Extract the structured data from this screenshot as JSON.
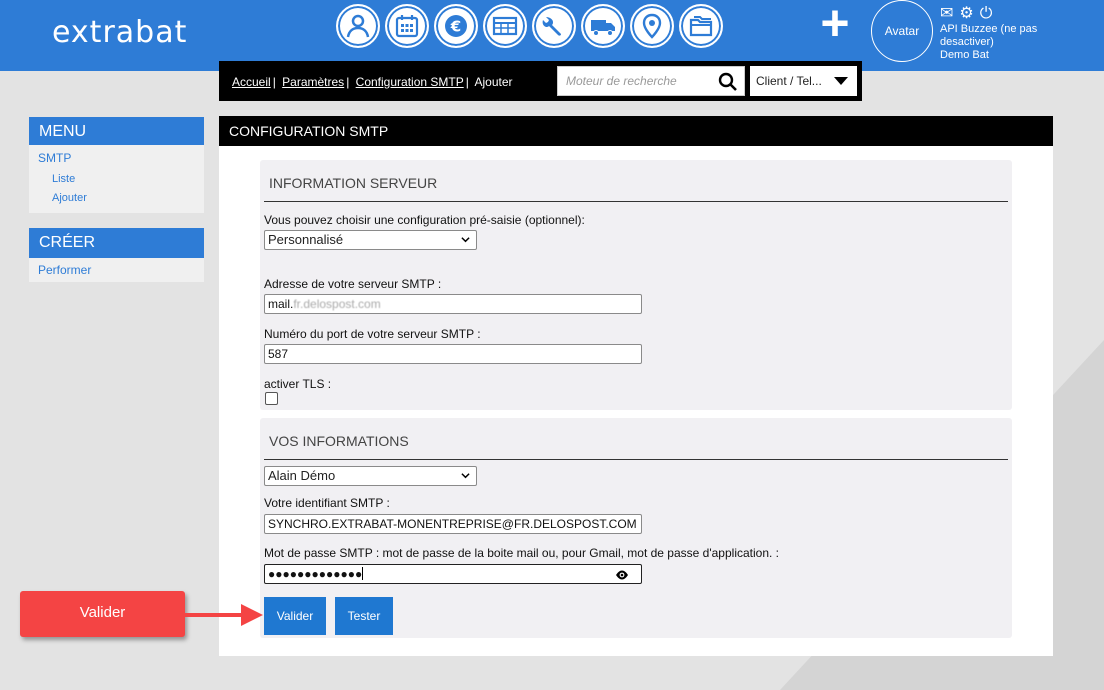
{
  "app": {
    "logo": "extrabat",
    "avatar_label": "Avatar",
    "user_line1": "API Buzzee (ne pas desactiver)",
    "user_line2": "Demo Bat",
    "nav_icons": [
      "user-icon",
      "calendar-icon",
      "euro-icon",
      "table-icon",
      "wrench-icon",
      "truck-icon",
      "map-pin-icon",
      "folders-icon"
    ]
  },
  "breadcrumb": {
    "items": [
      "Accueil",
      "Paramètres",
      "Configuration SMTP"
    ],
    "current": "Ajouter"
  },
  "search": {
    "placeholder": "Moteur de recherche",
    "scope": "Client / Tel..."
  },
  "sidebar": {
    "menu_title": "MENU",
    "menu_section": "SMTP",
    "menu_items": [
      "Liste",
      "Ajouter"
    ],
    "create_title": "CRÉER",
    "create_items": [
      "Performer"
    ]
  },
  "page": {
    "title": "CONFIGURATION SMTP"
  },
  "server": {
    "title": "INFORMATION SERVEUR",
    "preset_label": "Vous pouvez choisir une configuration pré-saisie (optionnel):",
    "preset_value": "Personnalisé",
    "host_label": "Adresse de votre serveur SMTP :",
    "host_value_prefix": "mail.",
    "host_value_blurred": "fr.delospost.com",
    "port_label": "Numéro du port de votre serveur SMTP :",
    "port_value": "587",
    "tls_label": "activer TLS :",
    "tls_checked": false
  },
  "info": {
    "title": "VOS INFORMATIONS",
    "user_select": "Alain Démo",
    "login_label": "Votre identifiant SMTP :",
    "login_value": "SYNCHRO.EXTRABAT-MONENTREPRISE@FR.DELOSPOST.COM",
    "password_label": "Mot de passe SMTP : mot de passe de la boite mail ou, pour Gmail, mot de passe d'application. :",
    "password_mask": "●●●●●●●●●●●●●"
  },
  "buttons": {
    "validate": "Valider",
    "test": "Tester"
  },
  "callout": {
    "text": "Valider"
  },
  "colors": {
    "brand_blue": "#2e7cd6",
    "button_blue": "#1f78d1",
    "callout_red": "#f44444"
  }
}
